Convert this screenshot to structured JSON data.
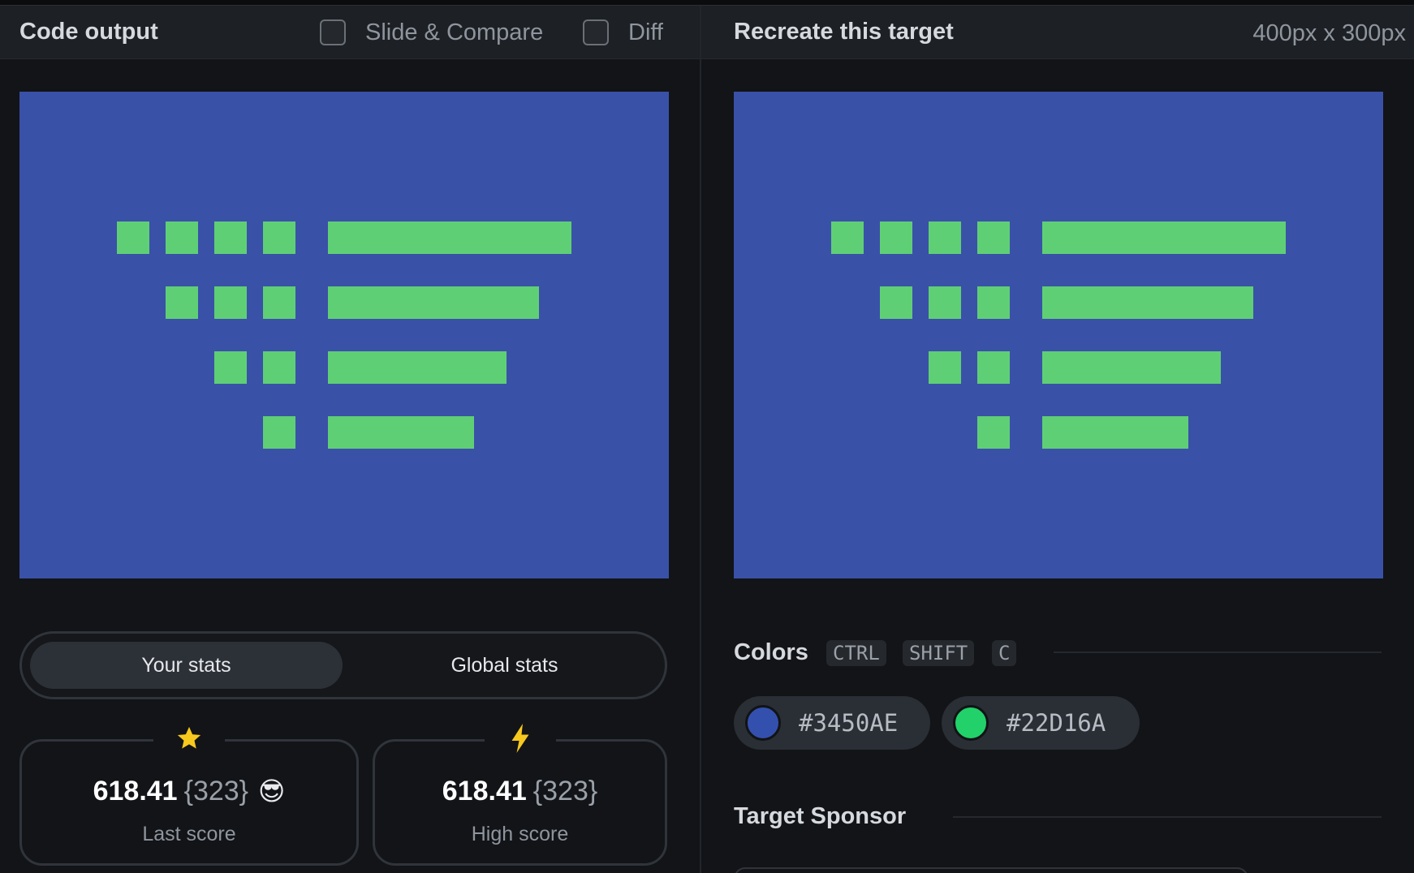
{
  "left_header": {
    "title": "Code output",
    "slide_compare_label": "Slide & Compare",
    "diff_label": "Diff"
  },
  "right_header": {
    "title": "Recreate this target",
    "size": "400px x 300px"
  },
  "canvas": {
    "background": "#3450AE",
    "foreground": "#22D16A"
  },
  "stats": {
    "your_tab": "Your stats",
    "global_tab": "Global stats",
    "last": {
      "icon": "star-icon",
      "score": "618.41",
      "chars": "{323}",
      "emoji": "😎",
      "label": "Last score"
    },
    "high": {
      "icon": "lightning-icon",
      "score": "618.41",
      "chars": "{323}",
      "label": "High score"
    }
  },
  "colors": {
    "title": "Colors",
    "shortcut": [
      "CTRL",
      "SHIFT",
      "C"
    ],
    "swatches": [
      {
        "hex": "#3450AE",
        "label": "#3450AE"
      },
      {
        "hex": "#22D16A",
        "label": "#22D16A"
      }
    ]
  },
  "sponsor": {
    "title": "Target Sponsor"
  }
}
